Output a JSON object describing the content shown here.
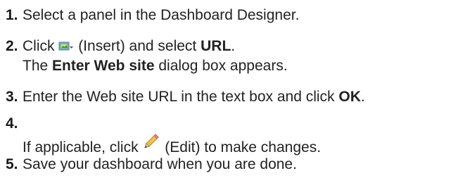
{
  "steps": [
    {
      "num": "1.",
      "text": "Select a panel in the Dashboard Designer."
    },
    {
      "num": "2.",
      "pre": "Click",
      "icon": "insert-icon",
      "mid": "(Insert) and select",
      "bold": "URL",
      "post": ".",
      "sub": {
        "pre": "The",
        "bold": "Enter Web site",
        "post": "dialog box appears."
      }
    },
    {
      "num": "3.",
      "pre": "Enter the Web site URL in the text box and click",
      "bold": "OK",
      "post": "."
    },
    {
      "num": "4.",
      "pre": "If applicable, click",
      "icon": "pencil-edit-icon",
      "post": "(Edit) to make changes."
    },
    {
      "num": "5.",
      "text": "Save your dashboard when you are done."
    }
  ]
}
